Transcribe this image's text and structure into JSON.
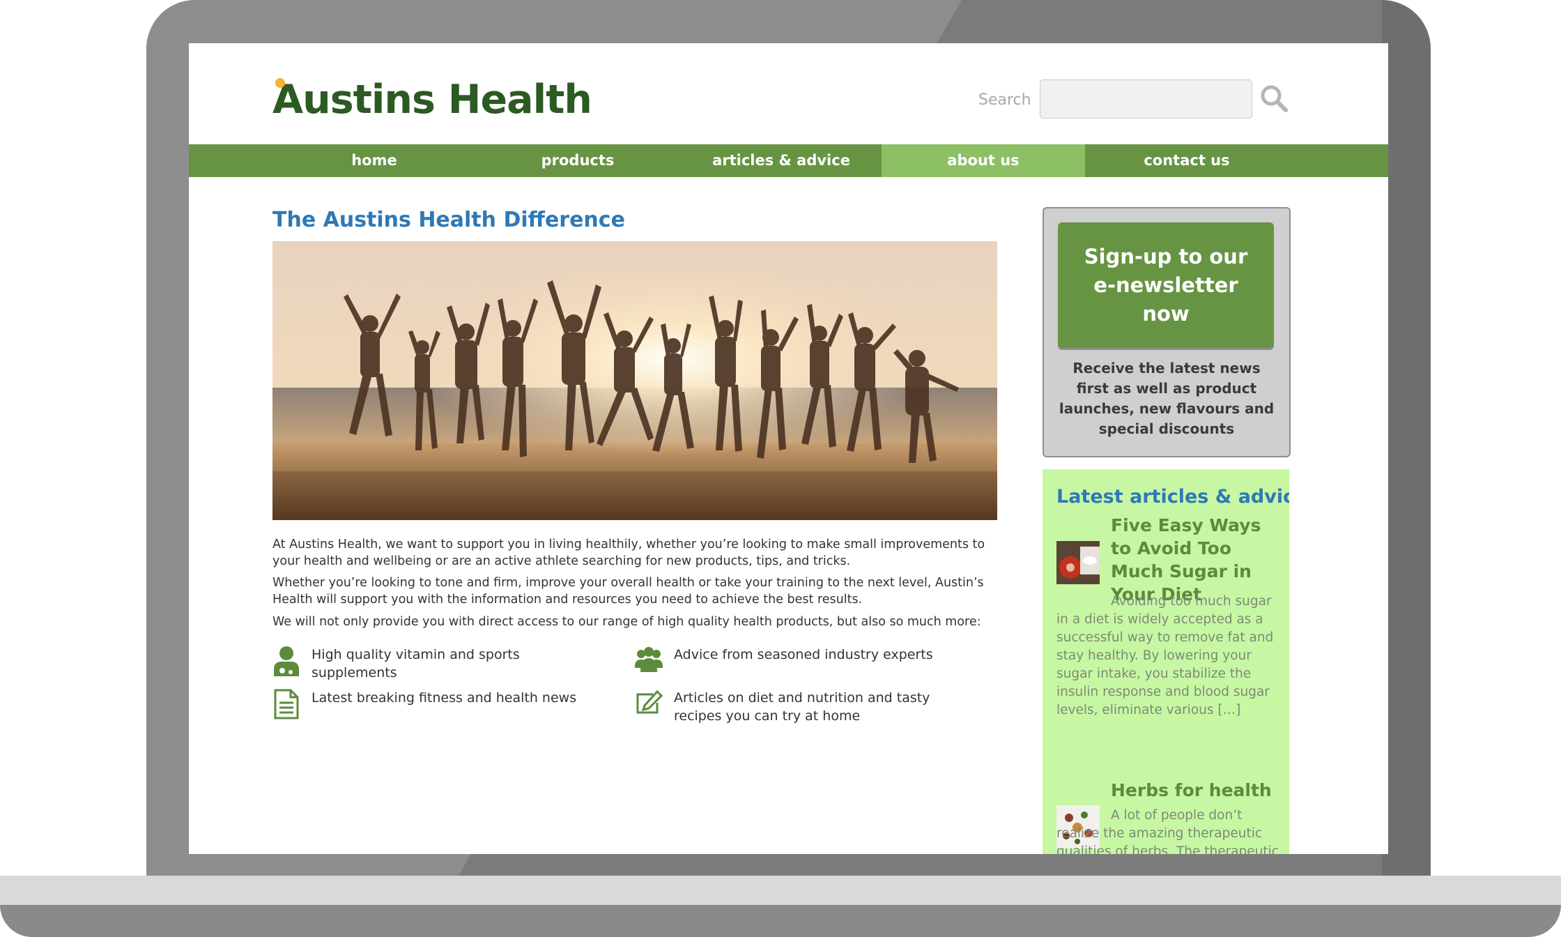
{
  "brand": {
    "logo_text": "Austins Health"
  },
  "search": {
    "label": "Search",
    "placeholder": ""
  },
  "nav": {
    "items": [
      {
        "label": "home"
      },
      {
        "label": "products"
      },
      {
        "label": "articles & advice"
      },
      {
        "label": "about us",
        "active": true
      },
      {
        "label": "contact us"
      }
    ]
  },
  "main": {
    "title": "The Austins Health Difference",
    "paragraphs": [
      "At Austins Health, we want to support you in living healthily, whether you’re looking to make small improvements to your health and wellbeing or are an active athlete searching for new products, tips, and tricks.",
      "Whether you’re looking to tone and firm, improve your overall health or take your training to the next level, Austin’s Health will support you with the information and resources you need to achieve the best results.",
      "We will not only provide you with direct access to our range of high quality health products, but also so much more:"
    ],
    "features": [
      {
        "icon": "doctor-icon",
        "text": "High quality vitamin and sports supplements"
      },
      {
        "icon": "group-icon",
        "text": "Advice from seasoned industry experts"
      },
      {
        "icon": "document-icon",
        "text": "Latest breaking fitness and health news"
      },
      {
        "icon": "edit-icon",
        "text": "Articles on diet and nutrition and tasty recipes you can try at home"
      }
    ]
  },
  "sidebar": {
    "signup": {
      "button": "Sign-up to our e-newsletter now",
      "description": "Receive the latest news first as well as product launches, new flavours and special discounts"
    },
    "articles": {
      "title": "Latest articles & advice",
      "items": [
        {
          "title": "Five Easy Ways to Avoid Too Much Sugar in Your Diet",
          "excerpt": "Avoiding too much sugar in a diet is widely accepted as a successful way to remove fat and stay healthy. By lowering your sugar intake, you stabilize the insulin response and blood sugar levels, eliminate various […]"
        },
        {
          "title": "Herbs for health",
          "excerpt": "A lot of people don’t realize the amazing therapeutic qualities of herbs. The therapeutic benefits of herbs can benefit our health and improve our"
        }
      ]
    }
  },
  "colors": {
    "brand_green": "#679443",
    "nav_active": "#8dc064",
    "title_blue": "#2e79b7",
    "sidebar_bg": "#c8f7a3"
  }
}
